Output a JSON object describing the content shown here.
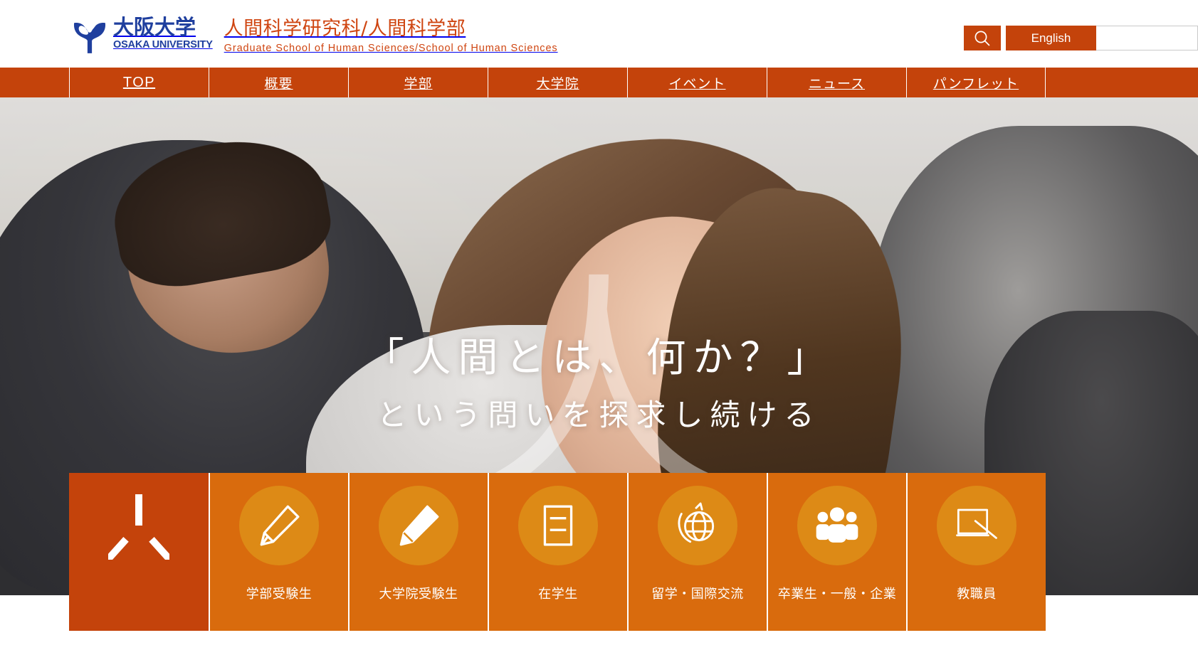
{
  "header": {
    "logo": {
      "icon": "osaka-university-crest-icon",
      "jp": "大阪大学",
      "en": "OSAKA UNIVERSITY",
      "color": "#1f3f9e"
    },
    "site_title_jp": "人間科学研究科/人間科学部",
    "site_title_en": "Graduate School of Human Sciences/School of Human Sciences",
    "title_color": "#cf4511",
    "search_icon": "search-icon",
    "english_label": "English",
    "search_value": "",
    "search_placeholder": ""
  },
  "nav": {
    "accent": "#c4430b",
    "items": [
      {
        "label": "TOP"
      },
      {
        "label": "概要"
      },
      {
        "label": "学部"
      },
      {
        "label": "大学院"
      },
      {
        "label": "イベント"
      },
      {
        "label": "ニュース"
      },
      {
        "label": "パンフレット"
      }
    ]
  },
  "hero": {
    "watermark": "人",
    "line1": "「人間とは、何か？」",
    "line2": "という問いを探求し続ける"
  },
  "tiles": {
    "bg": "#d96b0d",
    "first_bg": "#c4430b",
    "circle": "#dd8a16",
    "items": [
      {
        "label": "",
        "icon": "person-kanji-icon"
      },
      {
        "label": "学部受験生",
        "icon": "pencil-icon"
      },
      {
        "label": "大学院受験生",
        "icon": "pencil-icon"
      },
      {
        "label": "在学生",
        "icon": "book-icon"
      },
      {
        "label": "留学・国際交流",
        "icon": "globe-icon"
      },
      {
        "label": "卒業生・一般・企業",
        "icon": "people-group-icon"
      },
      {
        "label": "教職員",
        "icon": "blackboard-pointer-icon"
      }
    ]
  }
}
